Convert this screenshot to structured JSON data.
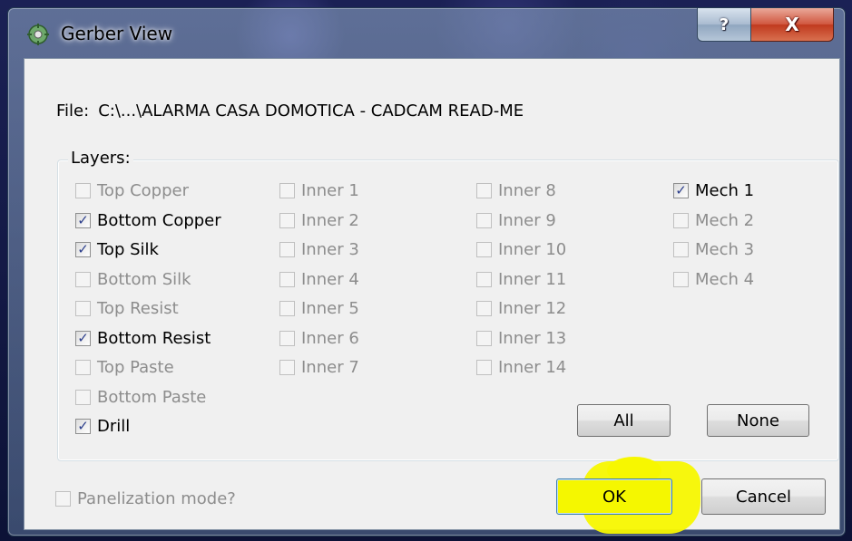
{
  "window": {
    "title": "Gerber View"
  },
  "file": {
    "label": "File:",
    "path": "C:\\...\\ALARMA CASA DOMOTICA - CADCAM READ-ME"
  },
  "layers": {
    "legend": "Layers:",
    "col1": [
      {
        "label": "Top Copper",
        "checked": false,
        "enabled": false
      },
      {
        "label": "Bottom Copper",
        "checked": true,
        "enabled": true
      },
      {
        "label": "Top Silk",
        "checked": true,
        "enabled": true
      },
      {
        "label": "Bottom Silk",
        "checked": false,
        "enabled": false
      },
      {
        "label": "Top Resist",
        "checked": false,
        "enabled": false
      },
      {
        "label": "Bottom Resist",
        "checked": true,
        "enabled": true
      },
      {
        "label": "Top Paste",
        "checked": false,
        "enabled": false
      },
      {
        "label": "Bottom Paste",
        "checked": false,
        "enabled": false
      },
      {
        "label": "Drill",
        "checked": true,
        "enabled": true
      }
    ],
    "col2": [
      {
        "label": "Inner 1",
        "checked": false,
        "enabled": false
      },
      {
        "label": "Inner 2",
        "checked": false,
        "enabled": false
      },
      {
        "label": "Inner 3",
        "checked": false,
        "enabled": false
      },
      {
        "label": "Inner 4",
        "checked": false,
        "enabled": false
      },
      {
        "label": "Inner 5",
        "checked": false,
        "enabled": false
      },
      {
        "label": "Inner 6",
        "checked": false,
        "enabled": false
      },
      {
        "label": "Inner 7",
        "checked": false,
        "enabled": false
      }
    ],
    "col3": [
      {
        "label": "Inner 8",
        "checked": false,
        "enabled": false
      },
      {
        "label": "Inner 9",
        "checked": false,
        "enabled": false
      },
      {
        "label": "Inner 10",
        "checked": false,
        "enabled": false
      },
      {
        "label": "Inner 11",
        "checked": false,
        "enabled": false
      },
      {
        "label": "Inner 12",
        "checked": false,
        "enabled": false
      },
      {
        "label": "Inner 13",
        "checked": false,
        "enabled": false
      },
      {
        "label": "Inner 14",
        "checked": false,
        "enabled": false
      }
    ],
    "col4": [
      {
        "label": "Mech 1",
        "checked": true,
        "enabled": true
      },
      {
        "label": "Mech 2",
        "checked": false,
        "enabled": false
      },
      {
        "label": "Mech 3",
        "checked": false,
        "enabled": false
      },
      {
        "label": "Mech 4",
        "checked": false,
        "enabled": false
      }
    ],
    "all_label": "All",
    "none_label": "None"
  },
  "panelization": {
    "label": "Panelization mode?",
    "checked": false,
    "enabled": false
  },
  "buttons": {
    "ok_label": "OK",
    "cancel_label": "Cancel"
  },
  "caption": {
    "help_glyph": "?",
    "close_glyph": "X"
  },
  "colors": {
    "ok_highlight": "#f5f700",
    "check": "#2c3f8c"
  }
}
